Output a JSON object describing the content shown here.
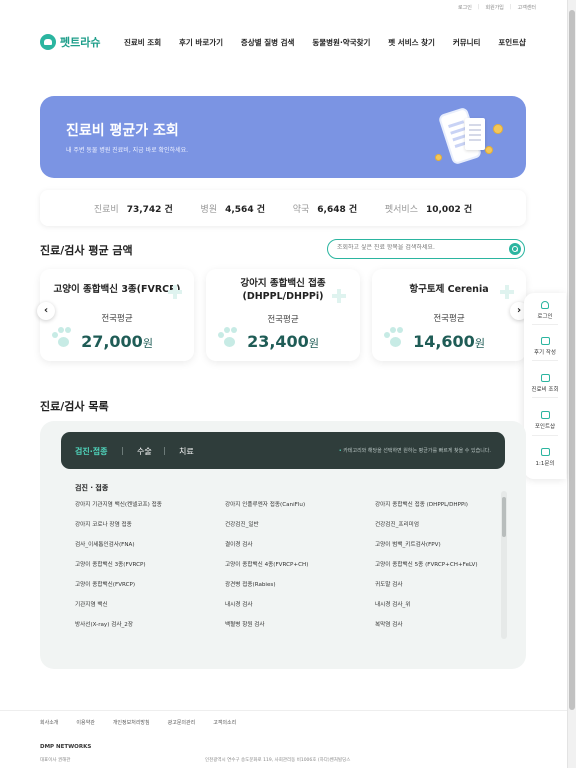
{
  "topbar": {
    "links": [
      "로그인",
      "회원가입",
      "고객센터"
    ]
  },
  "brand": {
    "name": "펫트라슈"
  },
  "nav": {
    "items": [
      "진료비 조회",
      "후기 바로가기",
      "증상별 질병 검색",
      "동물병원·약국찾기",
      "펫 서비스 찾기",
      "커뮤니티",
      "포인트샵"
    ]
  },
  "banner": {
    "title": "진료비 평균가 조회",
    "subtitle": "내 주변 동물 병원 진료비, 지금 바로 확인하세요."
  },
  "stats": [
    {
      "label": "진료비",
      "value": "73,742 건"
    },
    {
      "label": "병원",
      "value": "4,564 건"
    },
    {
      "label": "약국",
      "value": "6,648 건"
    },
    {
      "label": "펫서비스",
      "value": "10,002 건"
    }
  ],
  "avg_section": {
    "title": "진료/검사 평균 금액",
    "search_placeholder": "조회하고 싶은 진료 항목을 검색하세요."
  },
  "cards": [
    {
      "title": "고양이 종합백신 3종(FVRCP)",
      "sub": "전국평균",
      "price": "27,000",
      "unit": "원"
    },
    {
      "title": "강아지 종합백신 접종 (DHPPL/DHPPi)",
      "sub": "전국평균",
      "price": "23,400",
      "unit": "원"
    },
    {
      "title": "항구토제 Cerenia",
      "sub": "전국평균",
      "price": "14,600",
      "unit": "원"
    }
  ],
  "list_section": {
    "title": "진료/검사 목록",
    "tabs": [
      "검진·접종",
      "수술",
      "치료"
    ],
    "hint": "카테고리와 해당을 선택하면 원하는 평균가를 빠르게 찾을 수 있습니다.",
    "group_title": "검진 · 접종",
    "items": [
      "강아지 기관지염 백신(켄넬코프) 접종",
      "강아지 인플루엔자 접종(CaniFlu)",
      "강아지 종합백신 접종 (DHPPL/DHPPi)",
      "강아지 코로나 장염 접종",
      "건강검진_일반",
      "건강검진_프리미엄",
      "검사_이세톱인검사(FNA)",
      "결이경 검사",
      "고양이 범백_키트검사(FPV)",
      "고양이 종합백신 3종(FVRCP)",
      "고양이 종합백신 4종(FVRCP+CH)",
      "고양이 종합백신 5종 (FVRCP+CH+FeLV)",
      "고양이 종합백신(FVRCP)",
      "광견병 접종(Rabies)",
      "귀도말 검사",
      "기관지염 백신",
      "내시경 검사",
      "내시경 검사_위",
      "방사선(X-ray) 검사_2장",
      "백혈병 항원 검사",
      "복막염 검사"
    ]
  },
  "right_sidebar": {
    "items": [
      "로그인",
      "후기 작성",
      "진료비 조회",
      "포인트샵",
      "1:1문의"
    ]
  },
  "footer": {
    "links": [
      "회사소개",
      "이용약관",
      "개인정보처리방침",
      "광고문의관리",
      "고객의소리"
    ],
    "brand": "DMP NETWORKS",
    "rep": "대표이사  권해관",
    "address": "인천광역시 연수구 송도문화로 119, 사회관리동 비1006호 (하다)벤처빌딩스"
  },
  "colors": {
    "accent": "#2bb5a0",
    "banner": "#7b94e3",
    "price": "#1f5c56",
    "tab_bg": "#2f3d3b"
  }
}
